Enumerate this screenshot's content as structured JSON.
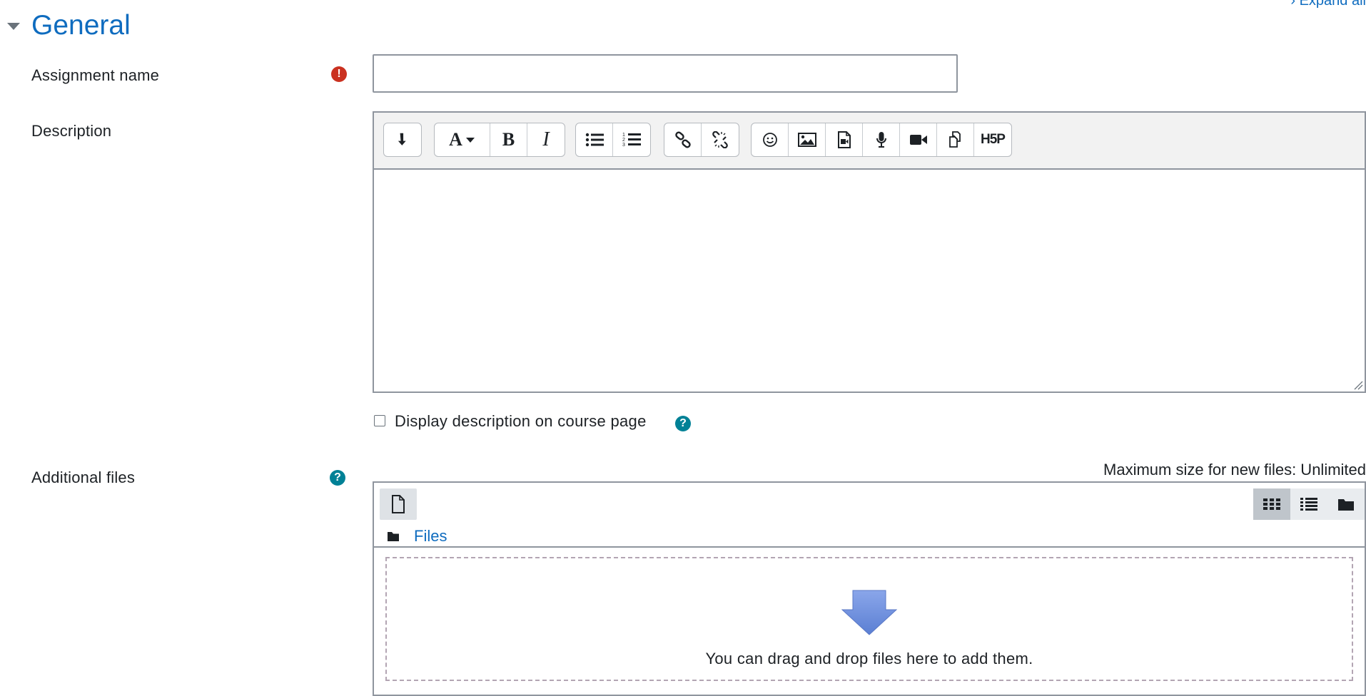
{
  "header": {
    "expand_all_label": "› Expand all"
  },
  "section": {
    "title": "General"
  },
  "fields": {
    "assignment_name": {
      "label": "Assignment name",
      "value": "",
      "placeholder": "",
      "required": true
    },
    "description": {
      "label": "Description",
      "value": ""
    },
    "display_description": {
      "label": "Display description on course page",
      "checked": false
    },
    "additional_files": {
      "label": "Additional files",
      "max_size_text": "Maximum size for new files: Unlimited",
      "path_label": "Files",
      "dropzone_text": "You can drag and drop files here to add them."
    }
  },
  "toolbar": {
    "groups": [
      [
        "show-more-icon"
      ],
      [
        "font-style-icon",
        "bold-icon",
        "italic-icon"
      ],
      [
        "unordered-list-icon",
        "ordered-list-icon"
      ],
      [
        "link-icon",
        "unlink-icon"
      ],
      [
        "emoji-icon",
        "image-icon",
        "media-icon",
        "record-audio-icon",
        "record-video-icon",
        "manage-files-icon",
        "h5p-icon"
      ]
    ],
    "h5p_label": "H5P"
  },
  "icons": {
    "required": "!",
    "help": "?"
  },
  "colors": {
    "link": "#0f6cbf",
    "required": "#ca3120",
    "help": "#008196",
    "arrow": "#6f8fdc"
  }
}
